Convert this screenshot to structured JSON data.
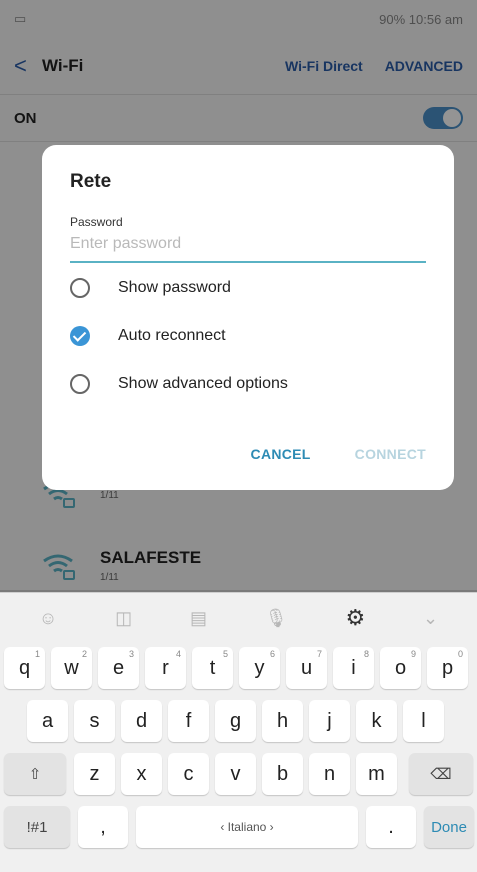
{
  "status": {
    "right": "90% 10:56 am"
  },
  "app_bar": {
    "back": "<",
    "title": "Wi-Fi",
    "wifi_direct": "Wi-Fi Direct",
    "advanced": "ADVANCED"
  },
  "toggle_row": {
    "label": "ON"
  },
  "networks": [
    {
      "name": "",
      "sub": "1/11"
    },
    {
      "name": "SALAFESTE",
      "sub": "1/11"
    }
  ],
  "dialog": {
    "title": "Rete",
    "password_label": "Password",
    "password_placeholder": "Enter password",
    "options": [
      {
        "label": "Show password",
        "checked": false
      },
      {
        "label": "Auto reconnect",
        "checked": true
      },
      {
        "label": "Show advanced options",
        "checked": false
      }
    ],
    "cancel": "CANCEL",
    "connect": "CONNECT"
  },
  "keyboard": {
    "toolbar_icons": [
      "emoji-icon",
      "sticker-icon",
      "clipboard-icon",
      "mic-icon",
      "settings-icon",
      "chevron-down-icon"
    ],
    "row1": [
      {
        "key": "q",
        "hint": "1"
      },
      {
        "key": "w",
        "hint": "2"
      },
      {
        "key": "e",
        "hint": "3"
      },
      {
        "key": "r",
        "hint": "4"
      },
      {
        "key": "t",
        "hint": "5"
      },
      {
        "key": "y",
        "hint": "6"
      },
      {
        "key": "u",
        "hint": "7"
      },
      {
        "key": "i",
        "hint": "8"
      },
      {
        "key": "o",
        "hint": "9"
      },
      {
        "key": "p",
        "hint": "0"
      }
    ],
    "row2": [
      "a",
      "s",
      "d",
      "f",
      "g",
      "h",
      "j",
      "k",
      "l"
    ],
    "row3": [
      "z",
      "x",
      "c",
      "v",
      "b",
      "n",
      "m"
    ],
    "shift": "⇧",
    "backspace": "⌫",
    "symbols": "!#1",
    "comma": ",",
    "space": "‹ Italiano ›",
    "period": ".",
    "done": "Done"
  }
}
